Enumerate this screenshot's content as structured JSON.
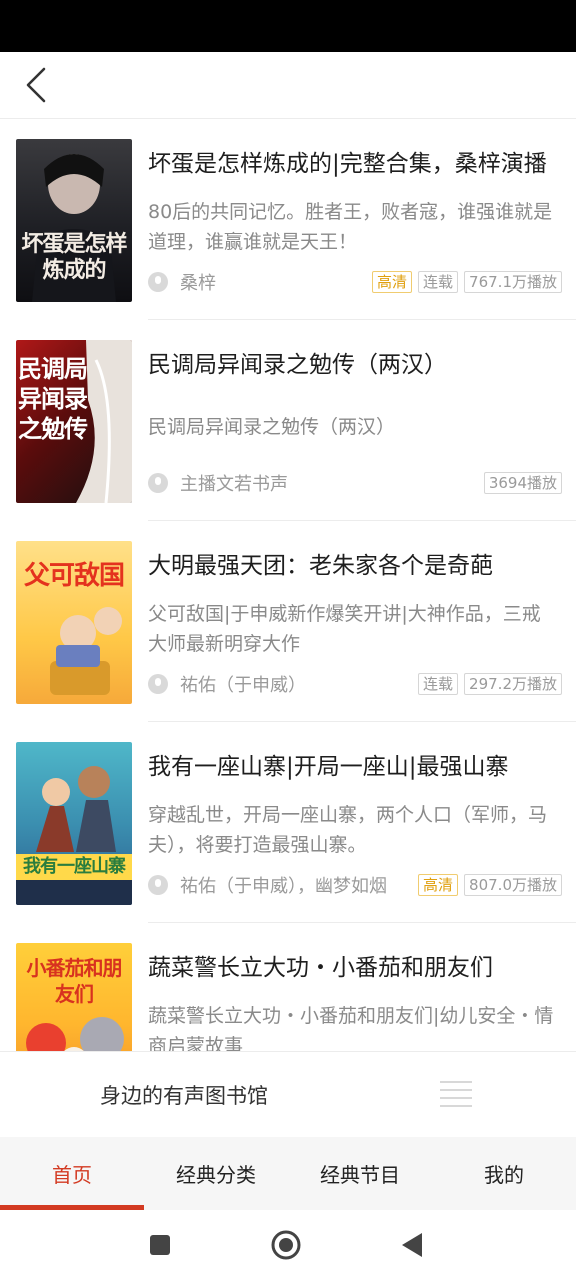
{
  "colors": {
    "accent": "#d33a22",
    "hd_tag": "#e0a010"
  },
  "header": {
    "back_icon": "chevron-left-icon"
  },
  "books": [
    {
      "title": "坏蛋是怎样炼成的|完整合集，桑梓演播",
      "description": "80后的共同记忆。胜者王，败者寇，谁强谁就是道理，谁赢谁就是天王！",
      "author": "桑梓",
      "tags": [
        "高清",
        "连载",
        "767.1万播放"
      ],
      "cover_text": "坏蛋是怎样炼成的"
    },
    {
      "title": "民调局异闻录之勉传（两汉）",
      "description": "民调局异闻录之勉传（两汉）",
      "author": "主播文若书声",
      "tags": [
        "3694播放"
      ],
      "cover_text": "民调局异闻录之勉传"
    },
    {
      "title": "大明最强天团：老朱家各个是奇葩",
      "description": "父可敌国|于申威新作爆笑开讲|大神作品，三戒大师最新明穿大作",
      "author": "祐佑（于申威）",
      "tags": [
        "连载",
        "297.2万播放"
      ],
      "cover_text": "父可敌国"
    },
    {
      "title": "我有一座山寨|开局一座山|最强山寨",
      "description": "穿越乱世，开局一座山寨，两个人口（军师，马夫），将要打造最强山寨。",
      "author": "祐佑（于申威），幽梦如烟",
      "tags": [
        "高清",
        "807.0万播放"
      ],
      "cover_text": "我有一座山寨"
    },
    {
      "title": "蔬菜警长立大功・小番茄和朋友们",
      "description": "蔬菜警长立大功・小番茄和朋友们|幼儿安全・情商启蒙故事",
      "author": "",
      "tags": [],
      "cover_text": "小番茄和朋友们"
    }
  ],
  "player": {
    "title": "身边的有声图书馆",
    "playlist_icon": "playlist-icon"
  },
  "tabs": [
    {
      "label": "首页",
      "active": true
    },
    {
      "label": "经典分类",
      "active": false
    },
    {
      "label": "经典节目",
      "active": false
    },
    {
      "label": "我的",
      "active": false
    }
  ],
  "system_nav": [
    "square-icon",
    "home-circle-icon",
    "back-triangle-icon"
  ]
}
